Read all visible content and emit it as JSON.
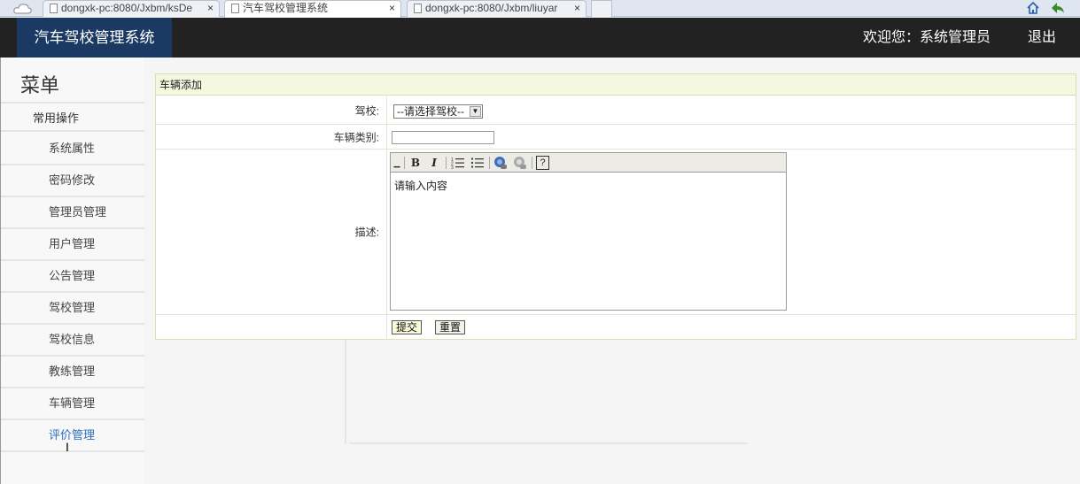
{
  "browser": {
    "tabs": [
      {
        "title": "dongxk-pc:8080/Jxbm/ksDe",
        "close": "×"
      },
      {
        "title": "汽车驾校管理系统",
        "close": "×"
      },
      {
        "title": "dongxk-pc:8080/Jxbm/liuyar",
        "close": "×"
      }
    ]
  },
  "header": {
    "brand": "汽车驾校管理系统",
    "welcome": "欢迎您：系统管理员",
    "logout": "退出",
    "accent_color": "#1a3a63"
  },
  "sidebar": {
    "title": "菜单",
    "group": "常用操作",
    "items": [
      {
        "label": "系统属性"
      },
      {
        "label": "密码修改"
      },
      {
        "label": "管理员管理"
      },
      {
        "label": "用户管理"
      },
      {
        "label": "公告管理"
      },
      {
        "label": "驾校管理"
      },
      {
        "label": "驾校信息"
      },
      {
        "label": "教练管理"
      },
      {
        "label": "车辆管理"
      },
      {
        "label": "评价管理"
      }
    ]
  },
  "form": {
    "title": "车辆添加",
    "school_label": "驾校:",
    "school_value": "--请选择驾校--",
    "type_label": "车辆类别:",
    "type_value": "",
    "desc_label": "描述:",
    "desc_placeholder": "请输入内容",
    "toolbar": {
      "bold": "B",
      "italic": "I",
      "help": "?"
    },
    "submit": "提交",
    "reset": "重置"
  }
}
